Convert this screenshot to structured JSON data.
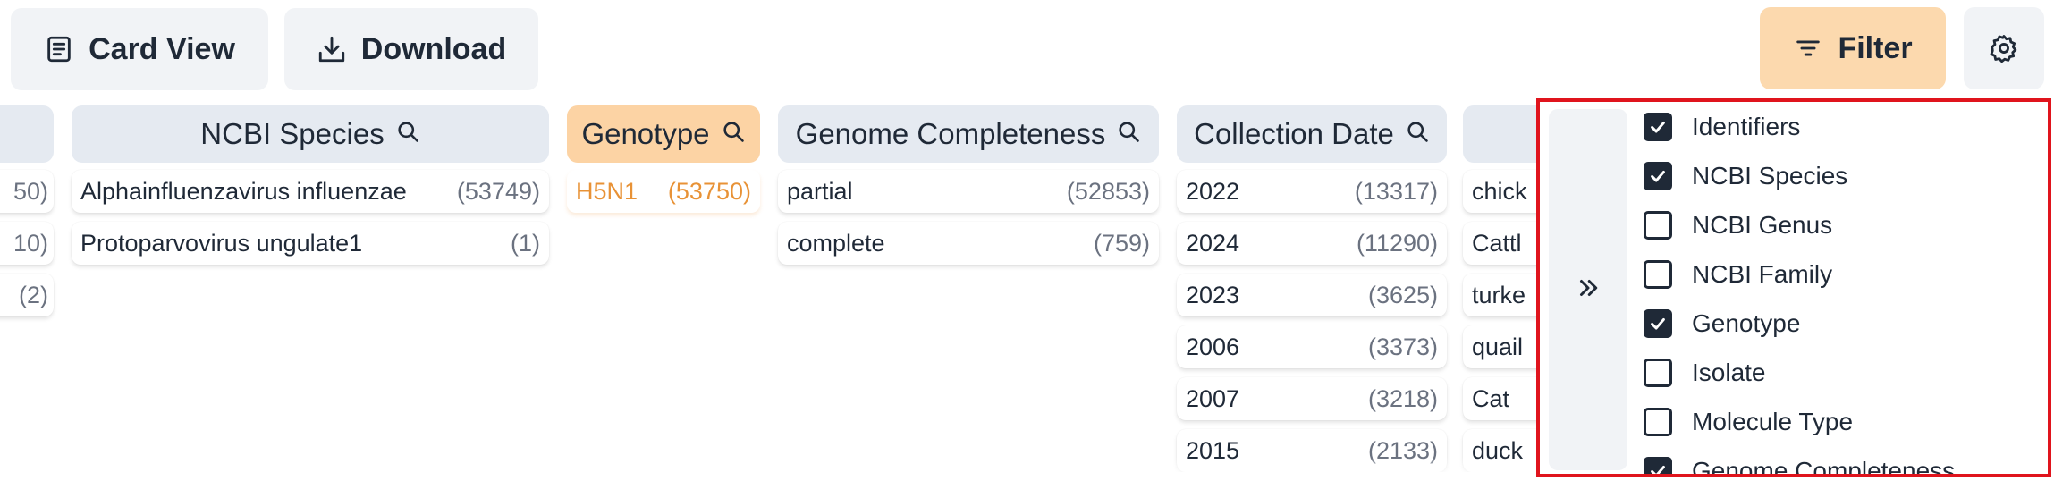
{
  "toolbar": {
    "card_view_label": "Card View",
    "download_label": "Download",
    "filter_label": "Filter"
  },
  "columns": [
    {
      "title": "",
      "rows": [
        {
          "label": "",
          "count": "50)"
        },
        {
          "label": "",
          "count": "10)"
        },
        {
          "label": "",
          "count": "(2)"
        }
      ]
    },
    {
      "title": "NCBI Species",
      "rows": [
        {
          "label": "Alphainfluenzavirus influenzae",
          "count": "(53749)"
        },
        {
          "label": "Protoparvovirus ungulate1",
          "count": "(1)"
        }
      ]
    },
    {
      "title": "Genotype",
      "rows": [
        {
          "label": "H5N1",
          "count": "(53750)"
        }
      ]
    },
    {
      "title": "Genome Completeness",
      "rows": [
        {
          "label": "partial",
          "count": "(52853)"
        },
        {
          "label": "complete",
          "count": "(759)"
        }
      ]
    },
    {
      "title": "Collection Date",
      "rows": [
        {
          "label": "2022",
          "count": "(13317)"
        },
        {
          "label": "2024",
          "count": "(11290)"
        },
        {
          "label": "2023",
          "count": "(3625)"
        },
        {
          "label": "2006",
          "count": "(3373)"
        },
        {
          "label": "2007",
          "count": "(3218)"
        },
        {
          "label": "2015",
          "count": "(2133)"
        }
      ]
    },
    {
      "title": "",
      "rows": [
        {
          "label": "chick",
          "count": ""
        },
        {
          "label": "Cattl",
          "count": ""
        },
        {
          "label": "turke",
          "count": ""
        },
        {
          "label": "quail",
          "count": ""
        },
        {
          "label": "Cat",
          "count": ""
        },
        {
          "label": "duck",
          "count": ""
        }
      ]
    }
  ],
  "column_panel": {
    "collapse_icon": "double-chevron-right-icon",
    "items": [
      {
        "label": "Identifiers",
        "checked": true
      },
      {
        "label": "NCBI Species",
        "checked": true
      },
      {
        "label": "NCBI Genus",
        "checked": false
      },
      {
        "label": "NCBI Family",
        "checked": false
      },
      {
        "label": "Genotype",
        "checked": true
      },
      {
        "label": "Isolate",
        "checked": false
      },
      {
        "label": "Molecule Type",
        "checked": false
      },
      {
        "label": "Genome Completeness",
        "checked": true
      }
    ]
  },
  "colors": {
    "accent": "#fcd9ae",
    "selected_text": "#e89236",
    "highlight_border": "#e0141d"
  }
}
